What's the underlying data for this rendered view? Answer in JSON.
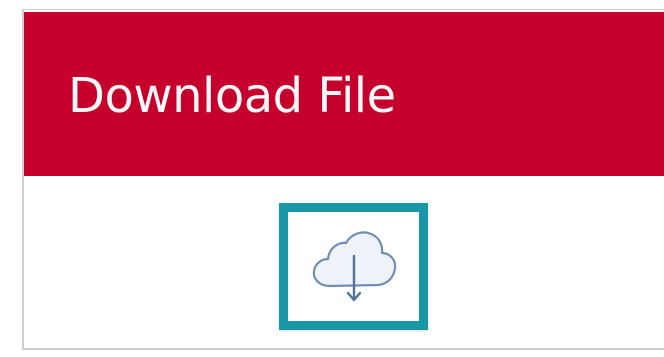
{
  "header": {
    "title": "Download File"
  },
  "download": {
    "icon": "cloud-download-icon"
  },
  "colors": {
    "header_background": "#c5002d",
    "header_text": "#f7f7f7",
    "button_border": "#1a97a6",
    "icon_stroke": "#6f8fb0",
    "icon_fill": "#eef3f9"
  }
}
